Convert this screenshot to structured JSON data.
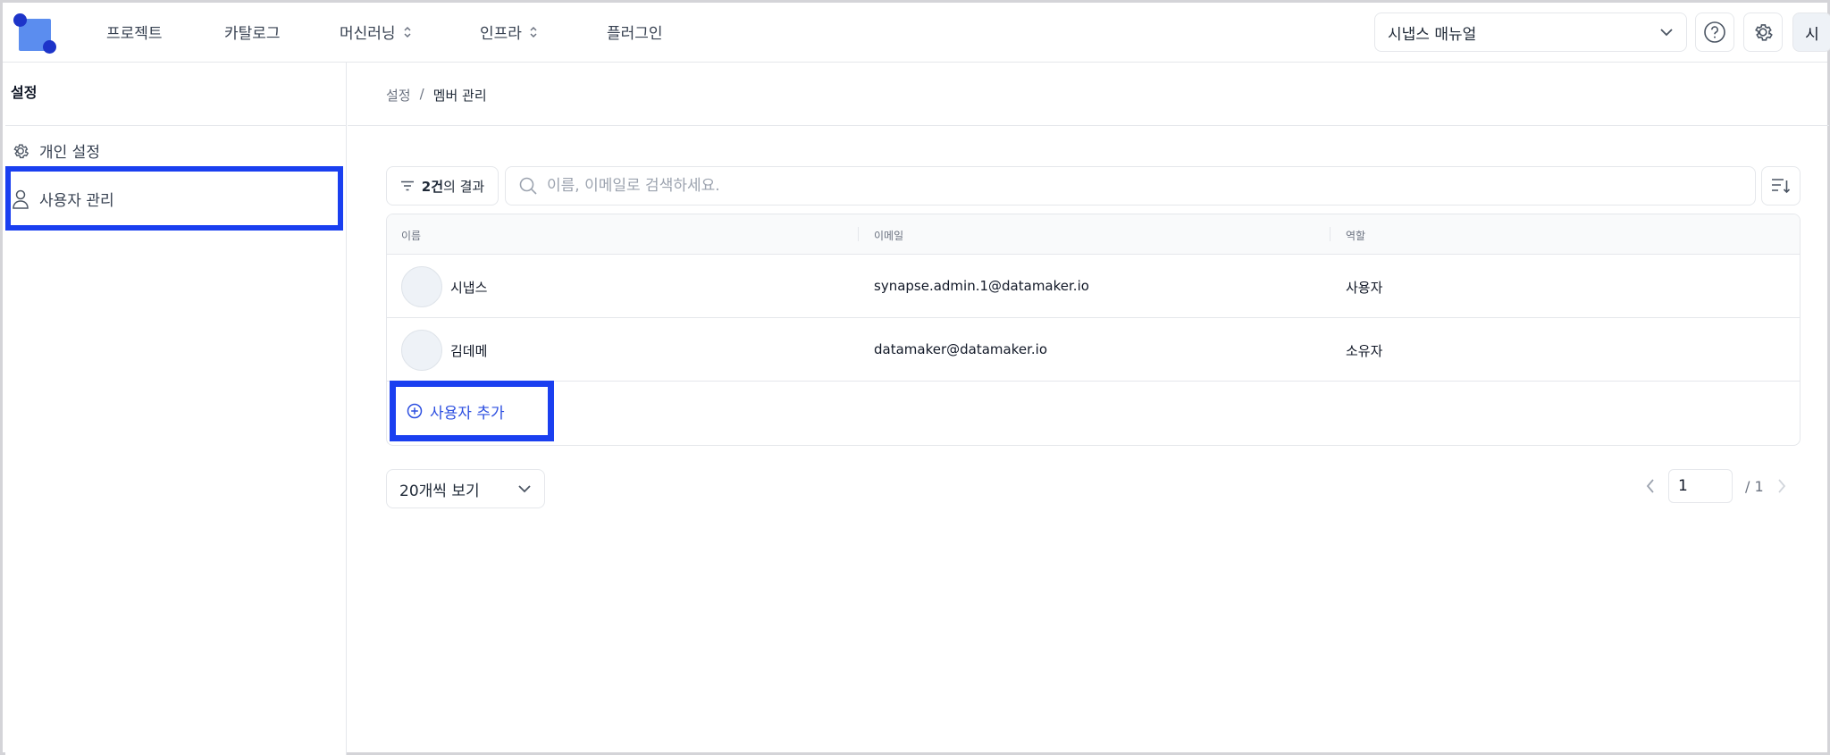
{
  "topbar": {
    "nav": [
      {
        "label": "프로젝트",
        "has_chevron": false
      },
      {
        "label": "카탈로그",
        "has_chevron": false
      },
      {
        "label": "머신러닝",
        "has_chevron": true
      },
      {
        "label": "인프라",
        "has_chevron": true
      },
      {
        "label": "플러그인",
        "has_chevron": false
      }
    ],
    "manual_select": "시냅스 매뉴얼",
    "avatar_initial": "시"
  },
  "sidebar": {
    "title": "설정",
    "items": [
      {
        "label": "개인 설정",
        "icon": "gear-icon"
      },
      {
        "label": "사용자 관리",
        "icon": "user-icon",
        "selected": true
      }
    ]
  },
  "breadcrumb": {
    "root": "설정",
    "sep": "/",
    "current": "멤버 관리"
  },
  "toolbar": {
    "result_count": "2건",
    "result_suffix": "의 결과",
    "search_placeholder": "이름, 이메일로 검색하세요."
  },
  "table": {
    "columns": [
      "이름",
      "이메일",
      "역할"
    ],
    "rows": [
      {
        "name": "시냅스",
        "email": "synapse.admin.1@datamaker.io",
        "role": "사용자"
      },
      {
        "name": "김데메",
        "email": "datamaker@datamaker.io",
        "role": "소유자"
      }
    ],
    "add_user_label": "사용자 추가"
  },
  "footer": {
    "page_size": "20개씩 보기",
    "page_current": "1",
    "page_total": "/ 1"
  },
  "colors": {
    "accent": "#1a3ff0",
    "link": "#2d4fe0",
    "logo": "#5b8def"
  }
}
